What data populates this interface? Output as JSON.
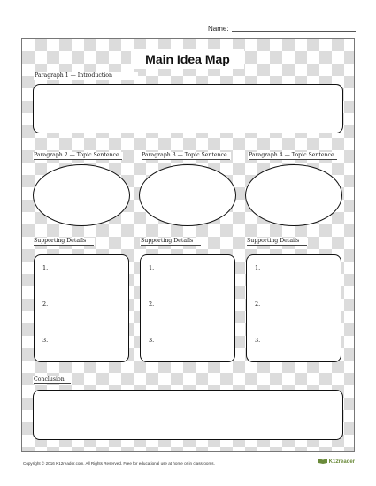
{
  "header": {
    "name_label": "Name:"
  },
  "title": "Main Idea Map",
  "sections": {
    "intro_label": "Paragraph 1 — Introduction",
    "p2_label": "Paragraph 2 — Topic Sentence",
    "p3_label": "Paragraph 3 — Topic Sentence",
    "p4_label": "Paragraph 4 — Topic Sentence",
    "support1_label": "Supporting Details",
    "support2_label": "Supporting Details",
    "support3_label": "Supporting Details",
    "conclusion_label": "Conclusion"
  },
  "details_numbers": [
    "1.",
    "2.",
    "3."
  ],
  "footer": {
    "copyright": "Copyright © 2016 K12reader.com. All Rights Reserved. Free for educational use at home or in classrooms.",
    "logo_text": "K12reader"
  },
  "colors": {
    "pattern": "#dcdcdc",
    "border": "#111111",
    "logo": "#6a8a3a"
  }
}
